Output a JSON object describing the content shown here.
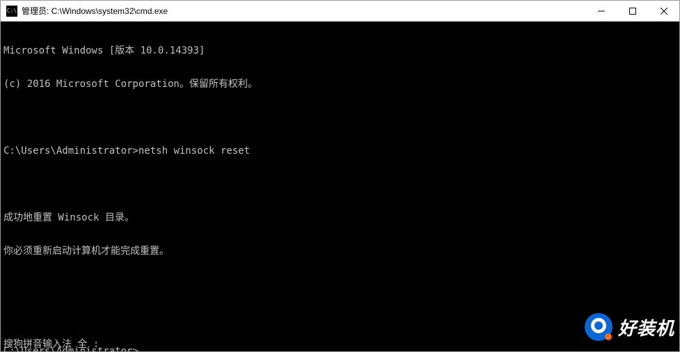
{
  "titlebar": {
    "icon_label": "C:\\",
    "title": "管理员: C:\\Windows\\system32\\cmd.exe"
  },
  "terminal": {
    "line1": "Microsoft Windows [版本 10.0.14393]",
    "line2": "(c) 2016 Microsoft Corporation。保留所有权利。",
    "blank1": "",
    "prompt1": "C:\\Users\\Administrator>",
    "command1": "netsh winsock reset",
    "blank2": "",
    "out1": "成功地重置 Winsock 目录。",
    "out2": "你必须重新启动计算机才能完成重置。",
    "blank3": "",
    "blank4": "",
    "prompt2": "C:\\Users\\Administrator>"
  },
  "ime": {
    "text": "搜狗拼音输入法 全 :"
  },
  "watermark": {
    "text": "好装机"
  }
}
